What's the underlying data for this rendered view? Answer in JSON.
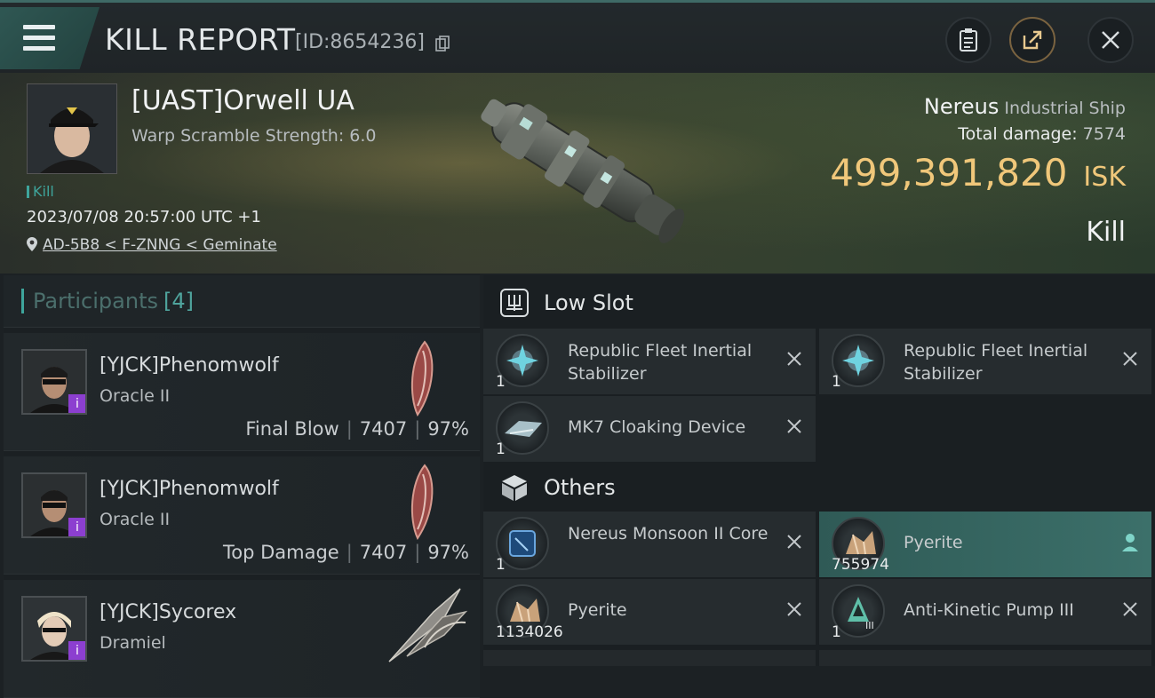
{
  "header": {
    "title": "KILL REPORT",
    "id_text": "[ID:8654236]",
    "icons": [
      "menu-icon",
      "copy-icon",
      "clipboard-icon",
      "share-icon",
      "close-icon"
    ]
  },
  "victim": {
    "name": "[UAST]Orwell UA",
    "warp_scramble": "Warp Scramble Strength: 6.0",
    "tag": "Kill",
    "datetime": "2023/07/08 20:57:00 UTC +1",
    "location": "AD-5B8 < F-ZNNG < Geminate",
    "ship_name": "Nereus",
    "ship_class": "Industrial Ship",
    "total_damage_label": "Total damage:",
    "total_damage_value": "7574",
    "isk_value": "499,391,820",
    "isk_unit": "ISK",
    "result": "Kill"
  },
  "participants": {
    "label": "Participants",
    "count": "[4]",
    "items": [
      {
        "name": "[YJCK]Phenomwolf",
        "ship": "Oracle II",
        "role": "Final Blow",
        "damage": "7407",
        "percent": "97%"
      },
      {
        "name": "[YJCK]Phenomwolf",
        "ship": "Oracle II",
        "role": "Top Damage",
        "damage": "7407",
        "percent": "97%"
      },
      {
        "name": "[YJCK]Sycorex",
        "ship": "Dramiel",
        "role": "",
        "damage": "",
        "percent": ""
      }
    ]
  },
  "low_slot": {
    "label": "Low Slot",
    "items": [
      {
        "name": "Republic Fleet Inertial Stabilizer",
        "qty": "1"
      },
      {
        "name": "Republic Fleet Inertial Stabilizer",
        "qty": "1"
      },
      {
        "name": "MK7 Cloaking Device",
        "qty": "1"
      }
    ]
  },
  "others": {
    "label": "Others",
    "items": [
      {
        "name": "Nereus Monsoon II Core",
        "qty": "1"
      },
      {
        "name": "Pyerite",
        "qty": "755974"
      },
      {
        "name": "Pyerite",
        "qty": "1134026"
      },
      {
        "name": "Anti-Kinetic Pump III",
        "qty": "1"
      }
    ]
  },
  "colors": {
    "accent_teal": "#3ea59c",
    "isk_gold": "#f0c77a",
    "badge_purple": "#8c3fd0",
    "highlight_row": "#3c706a"
  }
}
